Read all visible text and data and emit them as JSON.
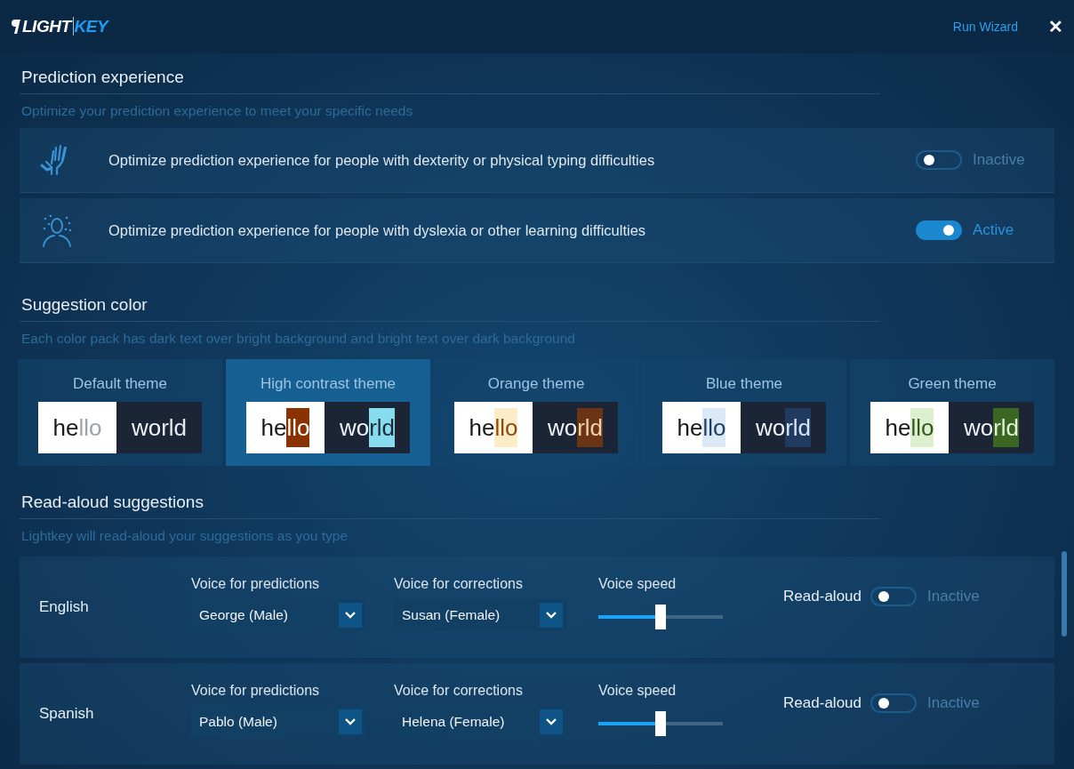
{
  "header": {
    "logo": {
      "word_1": "LIGHT",
      "word_2": "KEY"
    },
    "wizard_link": "Run Wizard",
    "close": "✕"
  },
  "prediction": {
    "title": "Prediction experience",
    "subtitle": "Optimize your prediction experience to meet your specific needs",
    "options": [
      {
        "kind": "hand",
        "text": "Optimize prediction experience for people with dexterity or physical typing difficulties",
        "on": false,
        "state": "Inactive"
      },
      {
        "kind": "person",
        "text": "Optimize prediction experience for people with dyslexia or other learning difficulties",
        "on": true,
        "state": "Active"
      }
    ]
  },
  "suggestion_color": {
    "title": "Suggestion color",
    "subtitle": "Each color pack has dark text over bright background and bright text over dark background",
    "themes": [
      {
        "kind": "default",
        "name": "Default theme",
        "selected": false,
        "light": [
          "he",
          "llo"
        ],
        "dark": [
          "wo",
          "rld"
        ]
      },
      {
        "kind": "high-contrast",
        "name": "High contrast theme",
        "selected": true,
        "light": [
          "he",
          "llo"
        ],
        "dark": [
          "wo",
          "rld"
        ]
      },
      {
        "kind": "orange",
        "name": "Orange theme",
        "selected": false,
        "light": [
          "he",
          "llo"
        ],
        "dark": [
          "wo",
          "rld"
        ]
      },
      {
        "kind": "blue",
        "name": "Blue theme",
        "selected": false,
        "light": [
          "he",
          "llo"
        ],
        "dark": [
          "wo",
          "rld"
        ]
      },
      {
        "kind": "green",
        "name": "Green theme",
        "selected": false,
        "light": [
          "he",
          "llo"
        ],
        "dark": [
          "wo",
          "rld"
        ]
      }
    ]
  },
  "read_aloud": {
    "title": "Read-aloud suggestions",
    "subtitle": "Lightkey will read-aloud your suggestions as you type",
    "languages": [
      {
        "name": "English",
        "predictions": {
          "label": "Voice for predictions",
          "value": "George (Male)"
        },
        "corrections": {
          "label": "Voice for corrections",
          "value": "Susan (Female)"
        },
        "speed": {
          "label": "Voice speed",
          "level": 0.5
        },
        "toggle": {
          "label": "Read-aloud",
          "on": false,
          "state": "Inactive"
        }
      },
      {
        "name": "Spanish",
        "predictions": {
          "label": "Voice for predictions",
          "value": "Pablo (Male)"
        },
        "corrections": {
          "label": "Voice for corrections",
          "value": "Helena (Female)"
        },
        "speed": {
          "label": "Voice speed",
          "level": 0.5
        },
        "toggle": {
          "label": "Read-aloud",
          "on": false,
          "state": "Inactive"
        }
      }
    ]
  }
}
